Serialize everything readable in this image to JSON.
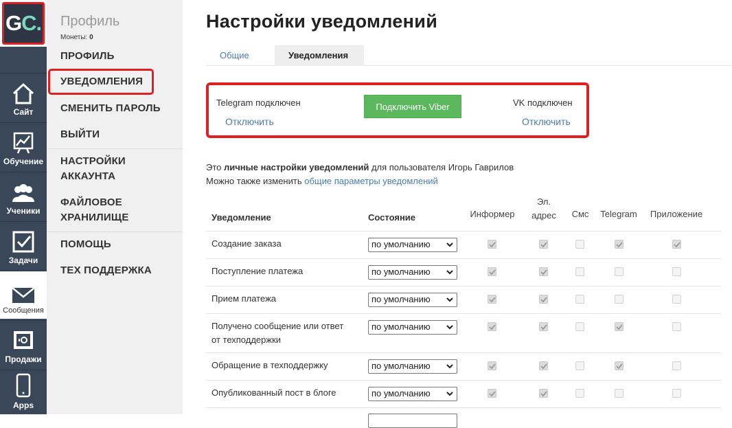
{
  "rail": {
    "logo_g": "G",
    "logo_c": "C.",
    "items": [
      {
        "label": "Сайт",
        "icon": "house-icon"
      },
      {
        "label": "Обучение",
        "icon": "chart-board-icon"
      },
      {
        "label": "Ученики",
        "icon": "users-icon"
      },
      {
        "label": "Задачи",
        "icon": "checkbox-icon"
      },
      {
        "label": "Сообщения",
        "icon": "envelope-icon"
      },
      {
        "label": "Продажи",
        "icon": "safe-icon"
      },
      {
        "label": "Apps",
        "icon": "phone-icon"
      }
    ]
  },
  "submenu": {
    "title": "Профиль",
    "coins_label": "Монеты:",
    "coins_value": "0",
    "items": [
      "ПРОФИЛЬ",
      "УВЕДОМЛЕНИЯ",
      "СМЕНИТЬ ПАРОЛЬ",
      "ВЫЙТИ",
      "НАСТРОЙКИ",
      "АККАУНТА",
      "ФАЙЛОВОЕ",
      "ХРАНИЛИЩЕ",
      "ПОМОЩЬ",
      "ТЕХ ПОДДЕРЖКА"
    ]
  },
  "main": {
    "title": "Настройки уведомлений",
    "tabs": [
      "Общие",
      "Уведомления"
    ],
    "connect": {
      "telegram_status": "Telegram подключен",
      "telegram_action": "Отключить",
      "viber_button": "Подключить Viber",
      "vk_status": "VK подключен",
      "vk_action": "Отключить"
    },
    "info_prefix": "Это ",
    "info_bold": "личные настройки уведомлений",
    "info_suffix": " для пользователя Игорь Гаврилов",
    "info2_prefix": "Можно также изменить ",
    "info2_link": "общие параметры уведомлений",
    "columns": {
      "notification": "Уведомление",
      "state": "Состояние",
      "informer": "Информер",
      "email_1": "Эл.",
      "email_2": "адрес",
      "sms": "Смс",
      "telegram": "Telegram",
      "app": "Приложение"
    },
    "rows": [
      {
        "name": "Создание заказа",
        "state": "по умолчанию",
        "checks": [
          true,
          true,
          false,
          true,
          true
        ]
      },
      {
        "name": "Поступление платежа",
        "state": "по умолчанию",
        "checks": [
          true,
          true,
          false,
          false,
          false
        ]
      },
      {
        "name": "Прием платежа",
        "state": "по умолчанию",
        "checks": [
          true,
          true,
          false,
          false,
          false
        ]
      },
      {
        "name": "Получено сообщение или ответ",
        "name2": "от техподдержки",
        "state": "по умолчанию",
        "checks": [
          true,
          true,
          false,
          true,
          false
        ]
      },
      {
        "name": "Обращение в техподдержку",
        "state": "по умолчанию",
        "checks": [
          true,
          true,
          false,
          true,
          false
        ]
      },
      {
        "name": "Опубликованный пост в блоге",
        "state": "по умолчанию",
        "checks": [
          true,
          true,
          false,
          false,
          false
        ]
      }
    ]
  }
}
